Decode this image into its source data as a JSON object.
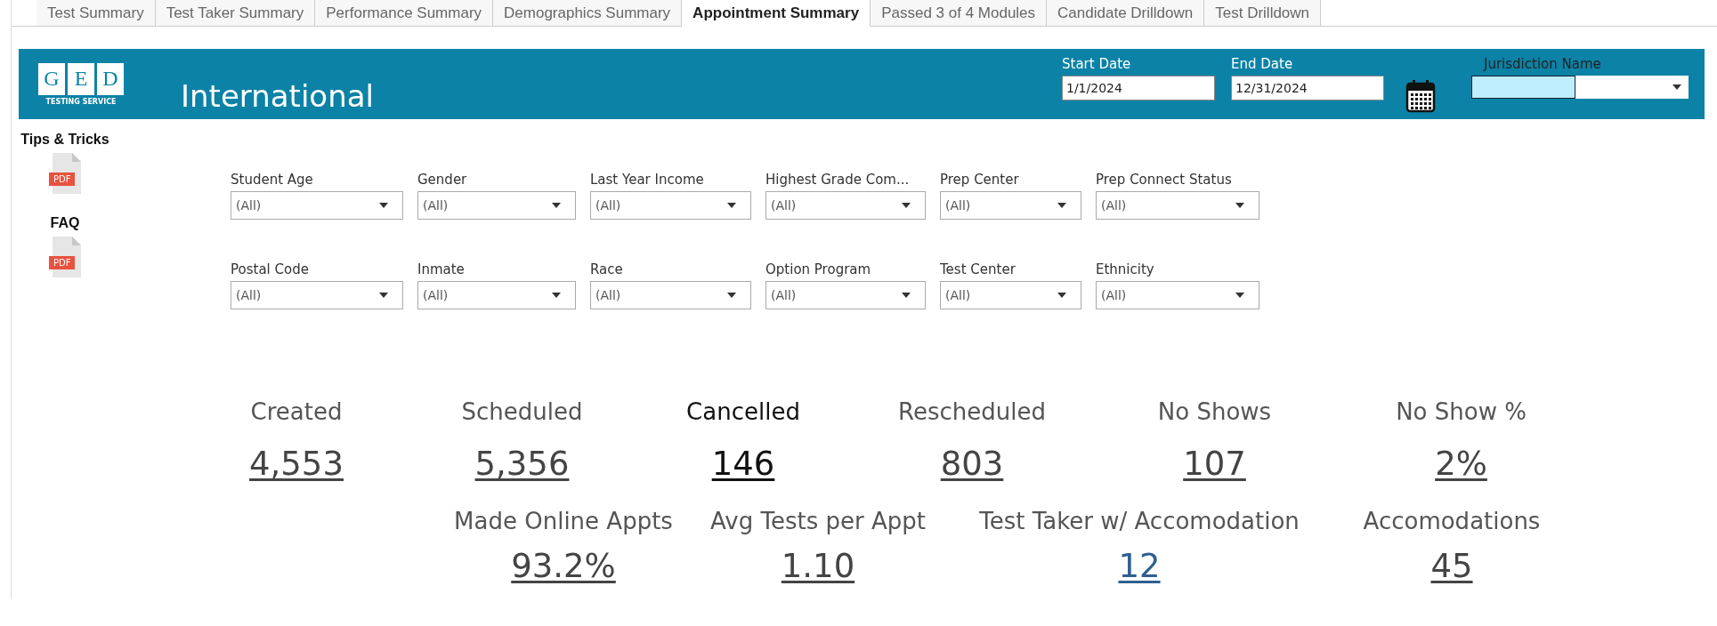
{
  "tabs": [
    {
      "label": "Test Summary",
      "selected": false
    },
    {
      "label": "Test Taker Summary",
      "selected": false
    },
    {
      "label": "Performance Summary",
      "selected": false
    },
    {
      "label": "Demographics Summary",
      "selected": false
    },
    {
      "label": "Appointment Summary",
      "selected": true
    },
    {
      "label": "Passed 3 of 4 Modules",
      "selected": false
    },
    {
      "label": "Candidate Drilldown",
      "selected": false
    },
    {
      "label": "Test Drilldown",
      "selected": false
    }
  ],
  "header": {
    "logo": {
      "letters": [
        "G",
        "E",
        "D"
      ],
      "tagline": "TESTING SERVICE"
    },
    "title": "International",
    "start_date": {
      "label": "Start Date",
      "value": "1/1/2024"
    },
    "end_date": {
      "label": "End Date",
      "value": "12/31/2024"
    },
    "jurisdiction": {
      "label": "Jurisdiction Name"
    }
  },
  "sidebar": [
    {
      "label": "Tips & Tricks",
      "badge": "PDF"
    },
    {
      "label": "FAQ",
      "badge": "PDF"
    }
  ],
  "filters": [
    [
      {
        "label": "Student Age",
        "value": "(All)"
      },
      {
        "label": "Gender",
        "value": "(All)"
      },
      {
        "label": "Last Year Income",
        "value": "(All)"
      },
      {
        "label": "Highest Grade Com...",
        "value": "(All)"
      },
      {
        "label": "Prep Center",
        "value": "(All)"
      },
      {
        "label": "Prep Connect Status",
        "value": "(All)"
      }
    ],
    [
      {
        "label": "Postal Code",
        "value": "(All)"
      },
      {
        "label": "Inmate",
        "value": "(All)"
      },
      {
        "label": "Race",
        "value": "(All)"
      },
      {
        "label": "Option Program",
        "value": "(All)"
      },
      {
        "label": "Test Center",
        "value": "(All)"
      },
      {
        "label": "Ethnicity",
        "value": "(All)"
      }
    ]
  ],
  "kpis": [
    [
      {
        "label": "Created",
        "value": "4,553",
        "color": "#444444"
      },
      {
        "label": "Scheduled",
        "value": "5,356",
        "color": "#444444"
      },
      {
        "label": "Cancelled",
        "value": "146",
        "color": "#111111"
      },
      {
        "label": "Rescheduled",
        "value": "803",
        "color": "#444444"
      },
      {
        "label": "No Shows",
        "value": "107",
        "color": "#444444"
      },
      {
        "label": "No Show %",
        "value": "2%",
        "color": "#444444"
      }
    ],
    [
      {
        "label": "Made Online Appts",
        "value": "93.2%",
        "color": "#444444"
      },
      {
        "label": "Avg Tests per Appt",
        "value": "1.10",
        "color": "#444444"
      },
      {
        "label": "Test Taker w/ Accomodation",
        "value": "12",
        "color": "#2f5f8f"
      },
      {
        "label": "Accomodations",
        "value": "45",
        "color": "#444444"
      }
    ]
  ]
}
